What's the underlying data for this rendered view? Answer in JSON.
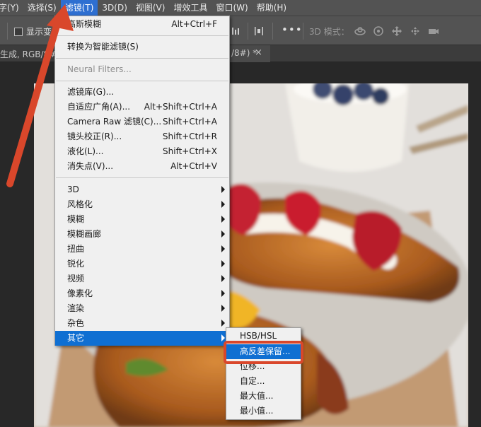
{
  "menubar": {
    "items": [
      {
        "label": "字(Y)"
      },
      {
        "label": "选择(S)"
      },
      {
        "label": "滤镜(T)"
      },
      {
        "label": "3D(D)"
      },
      {
        "label": "视图(V)"
      },
      {
        "label": "增效工具"
      },
      {
        "label": "窗口(W)"
      },
      {
        "label": "帮助(H)"
      }
    ],
    "active_index": 2
  },
  "options_bar": {
    "show_transform_label": "显示变",
    "mode_3d_label": "3D 模式：",
    "more_label": "•••"
  },
  "doc_tabs": {
    "left_text": "生成, RGB/8#",
    "right_text": "/8#) *",
    "close_glyph": "×"
  },
  "filter_menu": {
    "items": [
      {
        "label": "高斯模糊",
        "shortcut": "Alt+Ctrl+F"
      },
      {
        "label": "转换为智能滤镜(S)",
        "shortcut": ""
      },
      {
        "label": "Neural Filters...",
        "shortcut": "",
        "disabled": true
      },
      {
        "label": "滤镜库(G)...",
        "shortcut": ""
      },
      {
        "label": "自适应广角(A)...",
        "shortcut": "Alt+Shift+Ctrl+A"
      },
      {
        "label": "Camera Raw 滤镜(C)...",
        "shortcut": "Shift+Ctrl+A"
      },
      {
        "label": "镜头校正(R)...",
        "shortcut": "Shift+Ctrl+R"
      },
      {
        "label": "液化(L)...",
        "shortcut": "Shift+Ctrl+X"
      },
      {
        "label": "消失点(V)...",
        "shortcut": "Alt+Ctrl+V"
      },
      {
        "label": "3D",
        "submenu": true
      },
      {
        "label": "风格化",
        "submenu": true
      },
      {
        "label": "模糊",
        "submenu": true
      },
      {
        "label": "模糊画廊",
        "submenu": true
      },
      {
        "label": "扭曲",
        "submenu": true
      },
      {
        "label": "锐化",
        "submenu": true
      },
      {
        "label": "视频",
        "submenu": true
      },
      {
        "label": "像素化",
        "submenu": true
      },
      {
        "label": "渲染",
        "submenu": true
      },
      {
        "label": "杂色",
        "submenu": true
      },
      {
        "label": "其它",
        "submenu": true,
        "highlighted": true
      }
    ]
  },
  "other_submenu": {
    "items": [
      {
        "label": "HSB/HSL"
      },
      {
        "label": "高反差保留...",
        "highlighted": true
      },
      {
        "label": "位移..."
      },
      {
        "label": "自定..."
      },
      {
        "label": "最大值..."
      },
      {
        "label": "最小值..."
      }
    ]
  },
  "colors": {
    "highlight": "#0f6fd2",
    "annotation_red": "#d9472b",
    "menubar_bg": "#535353"
  }
}
